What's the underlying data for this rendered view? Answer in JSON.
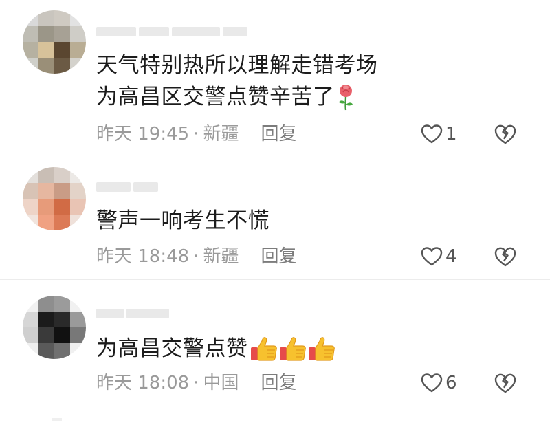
{
  "comments": [
    {
      "text_lines": [
        "天气特别热所以理解走错考场",
        "为高昌区交警点赞辛苦了"
      ],
      "text_emoji": "rose-icon",
      "time": "昨天 19:45",
      "dot": "·",
      "location": "新疆",
      "reply_label": "回复",
      "like_count": "1"
    },
    {
      "text_lines": [
        "警声一响考生不慌"
      ],
      "time": "昨天 18:48",
      "dot": "·",
      "location": "新疆",
      "reply_label": "回复",
      "like_count": "4"
    },
    {
      "text_lines": [
        "为高昌交警点赞"
      ],
      "text_emoji": "thumbs-up-icon",
      "text_emoji_count": 3,
      "time": "昨天 18:08",
      "dot": "·",
      "location": "中国",
      "reply_label": "回复",
      "like_count": "6"
    }
  ],
  "colors": {
    "text": "#1c1c1c",
    "meta": "#9a9a9a",
    "icon": "#555555",
    "thumb": "#f5b82e",
    "rose": "#e8606a"
  }
}
